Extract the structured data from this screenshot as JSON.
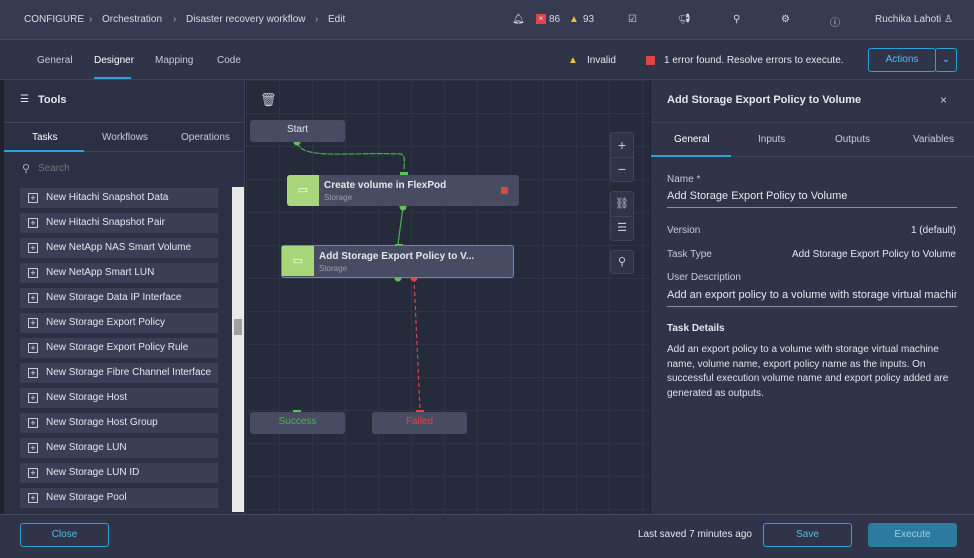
{
  "breadcrumb": [
    "CONFIGURE",
    "Orchestration",
    "Disaster recovery workflow",
    "Edit"
  ],
  "header": {
    "error_count": "86",
    "warning_count": "93",
    "user": "Ruchika Lahoti"
  },
  "tabs": [
    "General",
    "Designer",
    "Mapping",
    "Code"
  ],
  "status": {
    "invalid": "Invalid",
    "errors": "1 error found. Resolve errors to execute.",
    "actions": "Actions"
  },
  "tools": {
    "title": "Tools",
    "tabs": [
      "Tasks",
      "Workflows",
      "Operations"
    ],
    "search_placeholder": "Search",
    "items": [
      "New Hitachi Snapshot Data",
      "New Hitachi Snapshot Pair",
      "New NetApp NAS Smart Volume",
      "New NetApp Smart LUN",
      "New Storage Data IP Interface",
      "New Storage Export Policy",
      "New Storage Export Policy Rule",
      "New Storage Fibre Channel Interface",
      "New Storage Host",
      "New Storage Host Group",
      "New Storage LUN",
      "New Storage LUN ID",
      "New Storage Pool"
    ]
  },
  "canvas": {
    "start": "Start",
    "success": "Success",
    "failed": "Failed",
    "nodes": [
      {
        "title": "Create volume in FlexPod",
        "sub": "Storage"
      },
      {
        "title": "Add Storage Export Policy to V...",
        "sub": "Storage"
      }
    ]
  },
  "panel": {
    "title": "Add Storage Export Policy to Volume",
    "tabs": [
      "General",
      "Inputs",
      "Outputs",
      "Variables"
    ],
    "name_label": "Name *",
    "name_value": "Add Storage Export Policy to Volume",
    "version_label": "Version",
    "version_value": "1 (default)",
    "type_label": "Task Type",
    "type_value": "Add Storage Export Policy to Volume",
    "desc_label": "User Description",
    "desc_value": "Add an export policy to a volume with storage virtual machine",
    "details_label": "Task Details",
    "details": "Add an export policy to a volume with storage virtual machine name, volume name, export policy name as the inputs. On successful execution volume name and export policy added are generated as outputs."
  },
  "footer": {
    "close": "Close",
    "saved": "Last saved 7 minutes ago",
    "save": "Save",
    "execute": "Execute"
  }
}
